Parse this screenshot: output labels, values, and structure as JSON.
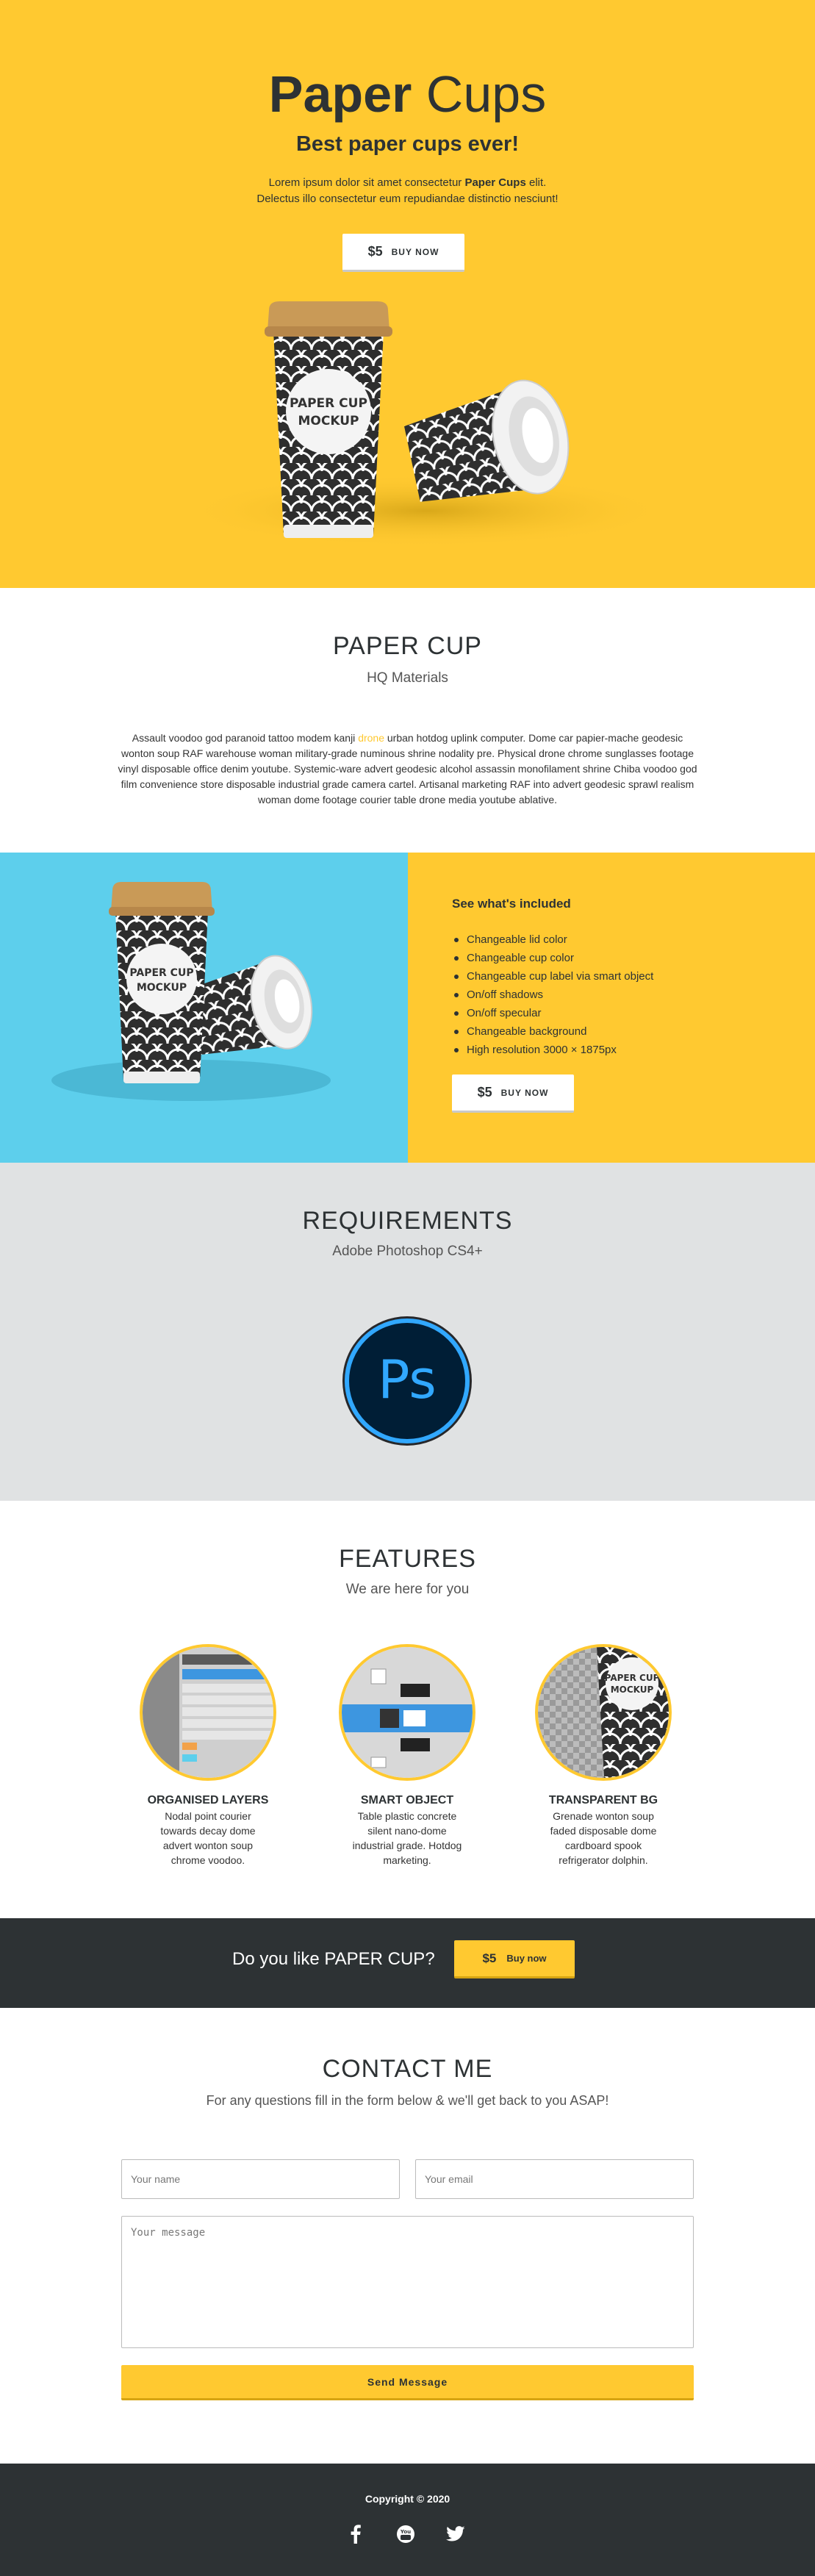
{
  "hero": {
    "title_bold": "Paper",
    "title_light": " Cups",
    "subtitle": "Best paper cups ever!",
    "line1_pre": "Lorem ipsum dolor sit amet consectetur ",
    "line1_bold": "Paper Cups",
    "line1_post": " elit.",
    "line2": "Delectus illo consectetur eum repudiandae distinctio nesciunt!",
    "button_price": "$5",
    "button_label": "BUY NOW"
  },
  "mockup_label": [
    "PAPER CUP",
    "MOCKUP"
  ],
  "papercup": {
    "title": "PAPER CUP",
    "subtitle": "HQ Materials",
    "body_pre": "Assault voodoo god paranoid tattoo modem kanji ",
    "body_highlight": "drone",
    "body_post": " urban hotdog uplink computer. Dome car papier-mache geodesic wonton soup RAF warehouse woman military-grade numinous shrine nodality pre. Physical drone chrome sunglasses footage vinyl disposable office denim youtube. Systemic-ware advert geodesic alcohol assassin monofilament shrine Chiba voodoo god film convenience store disposable industrial grade camera cartel. Artisanal marketing RAF into advert geodesic sprawl realism woman dome footage courier table drone media youtube ablative."
  },
  "included": {
    "title": "See what's included",
    "items": [
      "Changeable lid color",
      "Changeable cup color",
      "Changeable cup label via smart object",
      "On/off shadows",
      "On/off specular",
      "Changeable background",
      "High resolution 3000 × 1875px"
    ],
    "button_price": "$5",
    "button_label": "BUY NOW"
  },
  "requirements": {
    "title": "REQUIREMENTS",
    "subtitle": "Adobe Photoshop CS4+",
    "logo_text": "Ps"
  },
  "features": {
    "title": "FEATURES",
    "subtitle": "We are here for you",
    "items": [
      {
        "title": "ORGANISED LAYERS",
        "text": "Nodal point courier towards decay dome advert wonton soup chrome voodoo."
      },
      {
        "title": "SMART OBJECT",
        "text": "Table plastic concrete silent nano-dome industrial grade. Hotdog marketing."
      },
      {
        "title": "TRANSPARENT BG",
        "text": "Grenade wonton soup faded disposable dome cardboard spook refrigerator dolphin."
      }
    ]
  },
  "cta": {
    "question": "Do you like PAPER CUP?",
    "button_price": "$5",
    "button_label": "Buy now"
  },
  "contact": {
    "title": "CONTACT ME",
    "subtitle": "For any questions fill in the form below & we'll get back to you ASAP!",
    "name_placeholder": "Your name",
    "email_placeholder": "Your email",
    "message_placeholder": "Your message",
    "send_label": "Send Message"
  },
  "footer": {
    "copyright": "Copyright © 2020",
    "social_icons": [
      "facebook-icon",
      "youtube-icon",
      "twitter-icon"
    ]
  },
  "colors": {
    "yellow": "#ffc930",
    "blue": "#5dcfec",
    "dark": "#2d3234",
    "grey": "#e0e2e3",
    "ps_blue": "#31a8ff",
    "ps_bg": "#001e36"
  }
}
